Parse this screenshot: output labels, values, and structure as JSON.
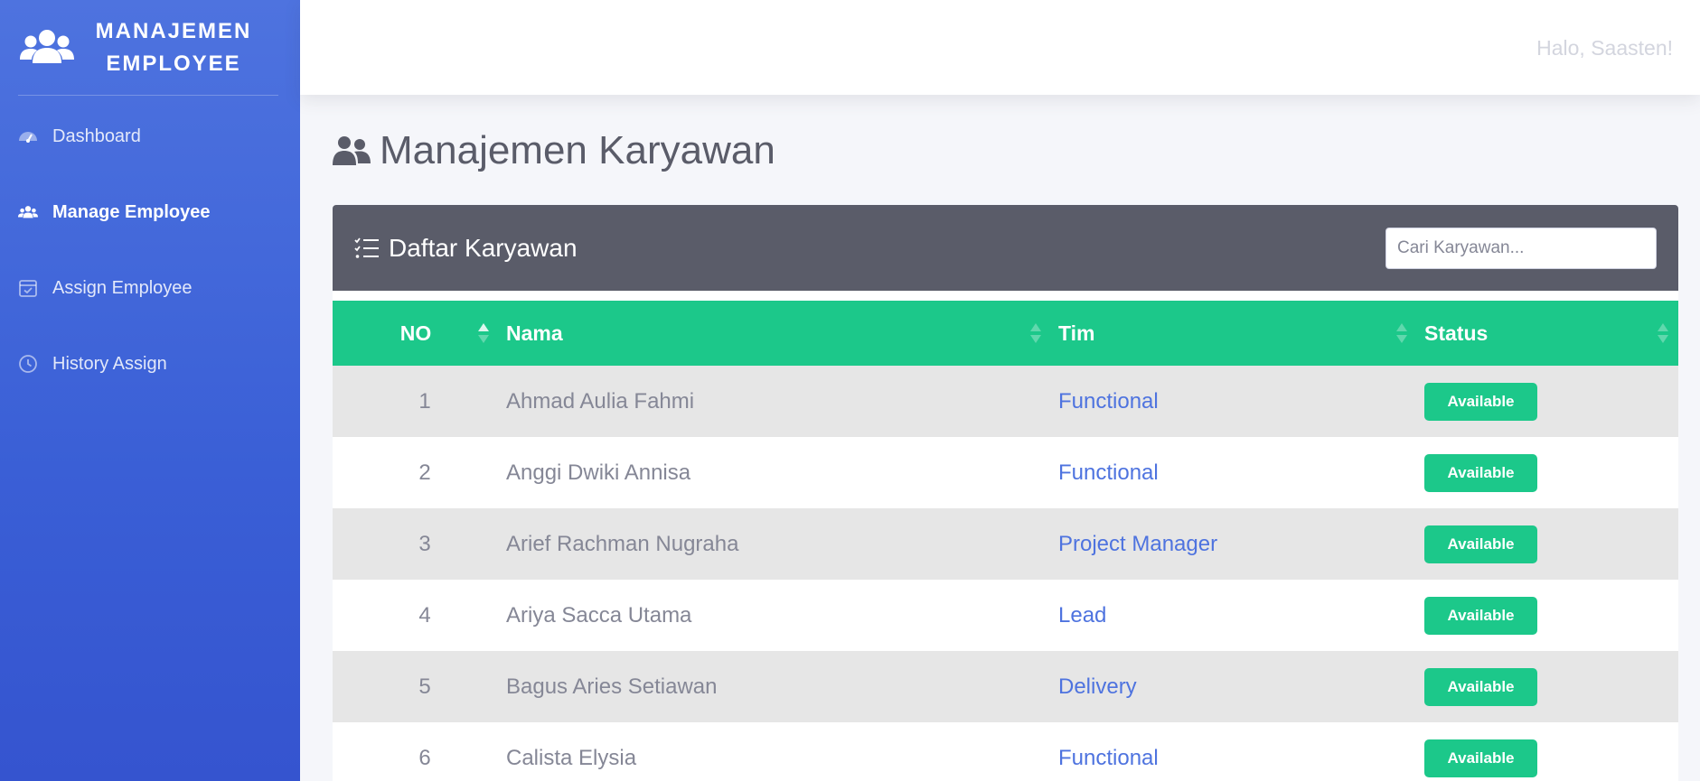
{
  "brand": {
    "line1": "MANAJEMEN",
    "line2": "EMPLOYEE",
    "icon": "users-icon"
  },
  "sidebar": {
    "items": [
      {
        "label": "Dashboard",
        "icon": "gauge-icon",
        "active": false
      },
      {
        "label": "Manage Employee",
        "icon": "users-icon",
        "active": true
      },
      {
        "label": "Assign Employee",
        "icon": "calendar-check-icon",
        "active": false
      },
      {
        "label": "History Assign",
        "icon": "clock-icon",
        "active": false
      }
    ]
  },
  "topbar": {
    "greeting": "Halo, Saasten!"
  },
  "page": {
    "title": "Manajemen Karyawan",
    "title_icon": "users-icon"
  },
  "card": {
    "title": "Daftar Karyawan",
    "title_icon": "list-check-icon",
    "search_placeholder": "Cari Karyawan..."
  },
  "table": {
    "headers": [
      "NO",
      "Nama",
      "Tim",
      "Status"
    ],
    "rows": [
      {
        "no": "1",
        "nama": "Ahmad Aulia Fahmi",
        "tim": "Functional",
        "status": "Available"
      },
      {
        "no": "2",
        "nama": "Anggi Dwiki Annisa",
        "tim": "Functional",
        "status": "Available"
      },
      {
        "no": "3",
        "nama": "Arief Rachman Nugraha",
        "tim": "Project Manager",
        "status": "Available"
      },
      {
        "no": "4",
        "nama": "Ariya Sacca Utama",
        "tim": "Lead",
        "status": "Available"
      },
      {
        "no": "5",
        "nama": "Bagus Aries Setiawan",
        "tim": "Delivery",
        "status": "Available"
      },
      {
        "no": "6",
        "nama": "Calista Elysia",
        "tim": "Functional",
        "status": "Available"
      }
    ]
  },
  "colors": {
    "sidebar": "#4e73df",
    "header_bar": "#5a5c69",
    "table_header": "#1cc88a",
    "badge": "#1cc88a",
    "link": "#4e73df"
  }
}
